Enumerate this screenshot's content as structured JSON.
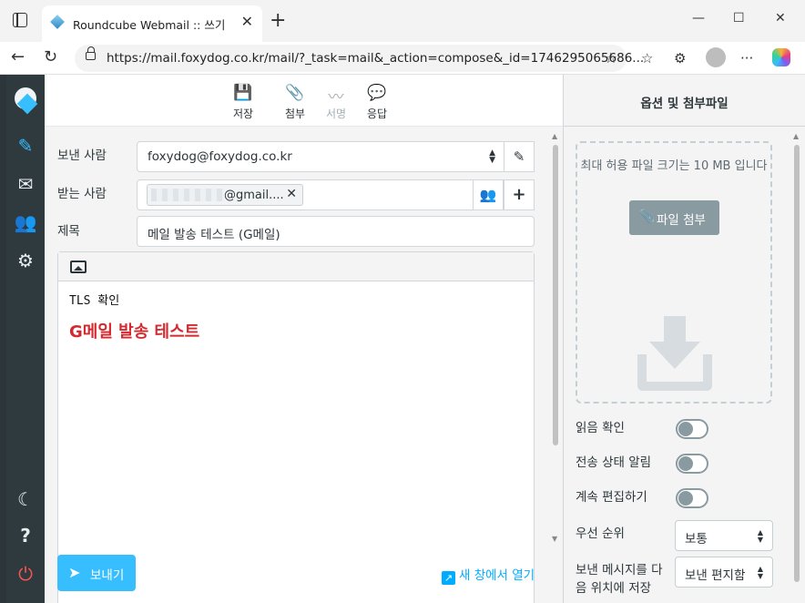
{
  "browser": {
    "tab_title": "Roundcube Webmail :: 쓰기",
    "url": "https://mail.foxydog.co.kr/mail/?_task=mail&_action=compose&_id=1746295065686..."
  },
  "toolbar": {
    "save_label": "저장",
    "attach_label": "첨부",
    "signature_label": "서명",
    "reply_label": "응답"
  },
  "compose": {
    "from_label": "보낸 사람",
    "from_value": "foxydog@foxydog.co.kr",
    "to_label": "받는 사람",
    "to_recipient": "@gmail....",
    "subject_label": "제목",
    "subject_value": "메일 발송 테스트 (G메일)",
    "body_line1": "TLS 확인",
    "body_line2": "G메일 발송 테스트",
    "send_label": "보내기",
    "open_new_window_label": "새 창에서 열기"
  },
  "options": {
    "title": "옵션 및 첨부파일",
    "max_size_text": "최대 허용 파일 크기는 10 MB 입니다",
    "attach_button": "파일 첨부",
    "read_receipt": "읽음 확인",
    "delivery_status": "전송 상태 알림",
    "keep_editing": "계속 편집하기",
    "priority_label": "우선 순위",
    "priority_value": "보통",
    "save_sent_label": "보낸 메시지를 다음 위치에 저장",
    "save_sent_value": "보낸 편지함",
    "colors": {
      "accent": "#37beff",
      "red_text": "#d3292f"
    }
  }
}
